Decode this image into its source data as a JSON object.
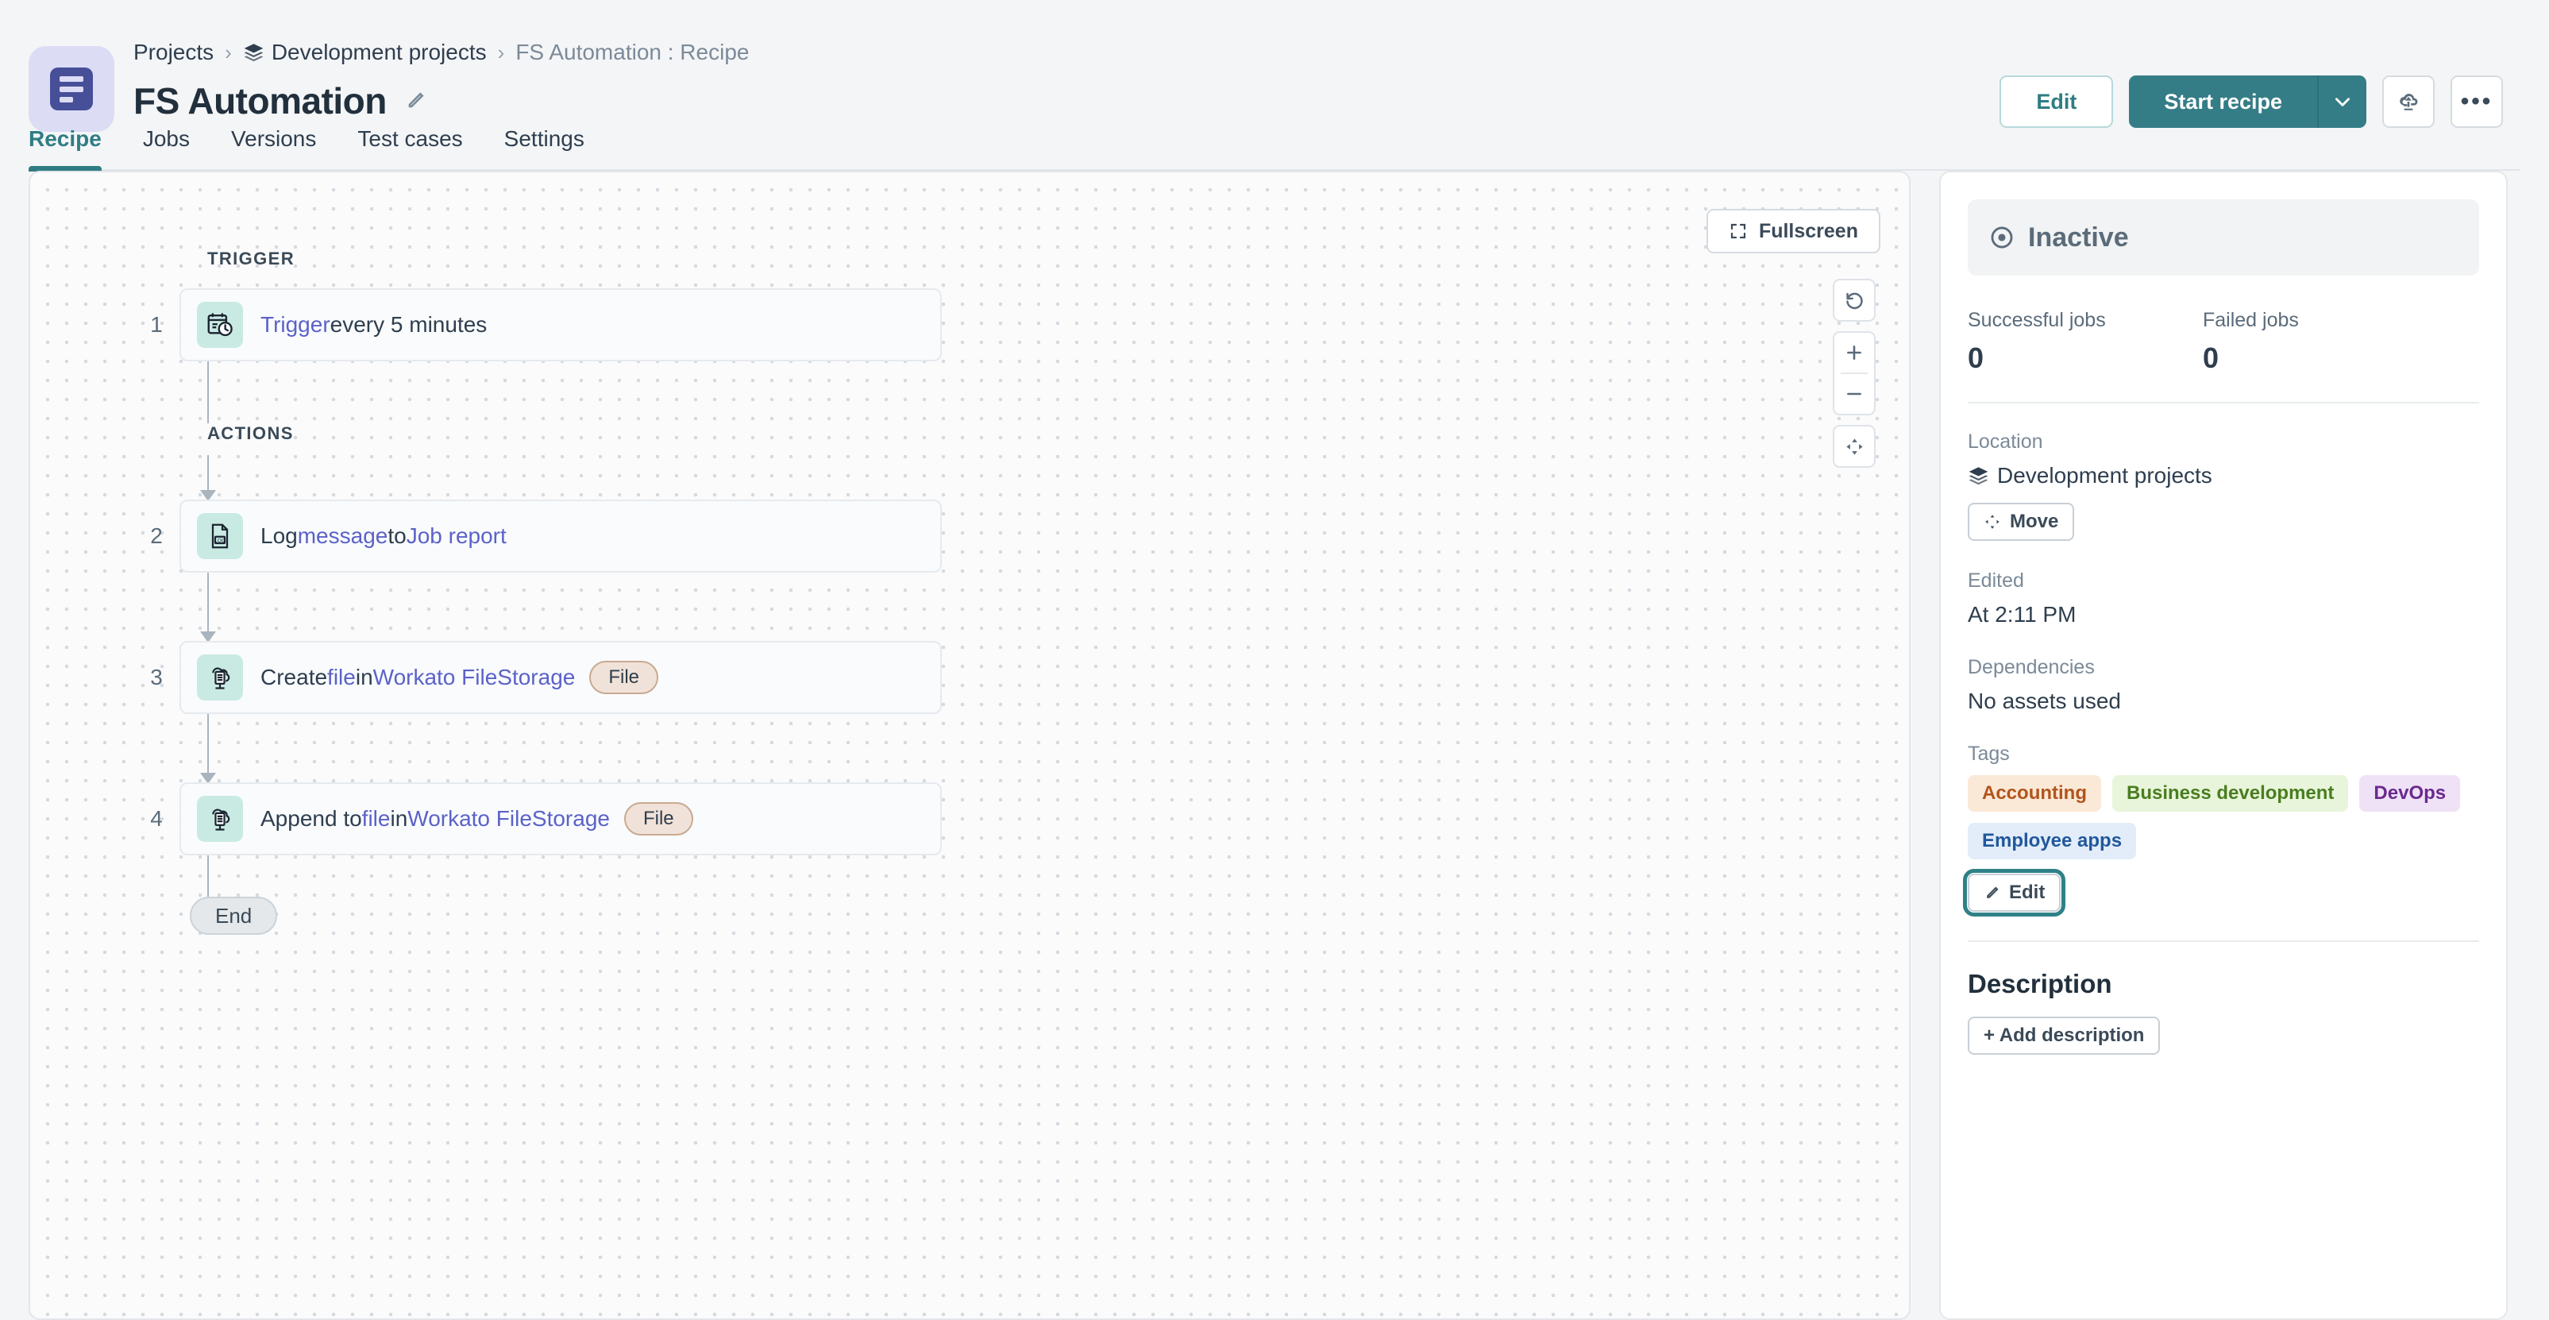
{
  "header": {
    "logo_icon": "recipe-list-icon",
    "breadcrumb": [
      {
        "label": "Projects",
        "icon": null,
        "muted": false
      },
      {
        "label": "Development projects",
        "icon": "layers-icon",
        "muted": false
      },
      {
        "label": "FS Automation : Recipe",
        "icon": null,
        "muted": true
      }
    ],
    "breadcrumb_separator": "›",
    "title": "FS Automation",
    "title_edit_icon": "pencil-icon",
    "actions": {
      "edit_label": "Edit",
      "start_recipe_label": "Start recipe",
      "caret_icon": "chevron-down-icon",
      "deploy_icon": "cloud-upload-icon",
      "more_icon": "ellipsis-icon",
      "more_label": "•••"
    },
    "tabs": [
      {
        "label": "Recipe",
        "active": true
      },
      {
        "label": "Jobs",
        "active": false
      },
      {
        "label": "Versions",
        "active": false
      },
      {
        "label": "Test cases",
        "active": false
      },
      {
        "label": "Settings",
        "active": false
      }
    ]
  },
  "canvas": {
    "fullscreen_label": "Fullscreen",
    "fullscreen_icon": "fullscreen-icon",
    "controls": [
      {
        "name": "reset-icon",
        "glyph": "↺"
      },
      {
        "name": "zoom-in-icon",
        "glyph": "+"
      },
      {
        "name": "zoom-out-icon",
        "glyph": "−"
      },
      {
        "name": "fit-view-icon",
        "glyph": "✥"
      }
    ],
    "trigger_section_label": "TRIGGER",
    "actions_section_label": "ACTIONS",
    "end_label": "End",
    "steps": [
      {
        "number": "1",
        "icon": "calendar-clock-icon",
        "parts": [
          {
            "text": "Trigger",
            "link": true
          },
          {
            "text": " every 5 minutes",
            "link": false
          }
        ],
        "badge": null
      },
      {
        "number": "2",
        "icon": "log-file-icon",
        "parts": [
          {
            "text": "Log ",
            "link": false
          },
          {
            "text": "message",
            "link": true
          },
          {
            "text": " to ",
            "link": false
          },
          {
            "text": "Job report",
            "link": true
          }
        ],
        "badge": null
      },
      {
        "number": "3",
        "icon": "filestorage-icon",
        "parts": [
          {
            "text": "Create ",
            "link": false
          },
          {
            "text": "file",
            "link": true
          },
          {
            "text": " in ",
            "link": false
          },
          {
            "text": "Workato FileStorage",
            "link": true
          }
        ],
        "badge": "File"
      },
      {
        "number": "4",
        "icon": "filestorage-icon",
        "parts": [
          {
            "text": "Append to ",
            "link": false
          },
          {
            "text": "file",
            "link": true
          },
          {
            "text": " in ",
            "link": false
          },
          {
            "text": "Workato FileStorage",
            "link": true
          }
        ],
        "badge": "File"
      }
    ]
  },
  "panel": {
    "status": {
      "label": "Inactive",
      "icon": "status-circle-icon"
    },
    "stats": [
      {
        "label": "Successful jobs",
        "value": "0"
      },
      {
        "label": "Failed jobs",
        "value": "0"
      }
    ],
    "location": {
      "label": "Location",
      "value": "Development projects",
      "icon": "layers-icon",
      "move_label": "Move",
      "move_icon": "move-arrows-icon"
    },
    "edited": {
      "label": "Edited",
      "value": "At 2:11 PM"
    },
    "dependencies": {
      "label": "Dependencies",
      "value": "No assets used"
    },
    "tags": {
      "label": "Tags",
      "items": [
        {
          "label": "Accounting",
          "bg": "#fbe9d8",
          "fg": "#b2541a"
        },
        {
          "label": "Business development",
          "bg": "#e8f5da",
          "fg": "#4a7d20"
        },
        {
          "label": "DevOps",
          "bg": "#efe2f7",
          "fg": "#6b2a8f"
        },
        {
          "label": "Employee apps",
          "bg": "#e2edf9",
          "fg": "#21579c"
        }
      ],
      "edit_label": "Edit",
      "edit_icon": "pencil-icon"
    },
    "description": {
      "title": "Description",
      "add_label": "+ Add description"
    }
  }
}
